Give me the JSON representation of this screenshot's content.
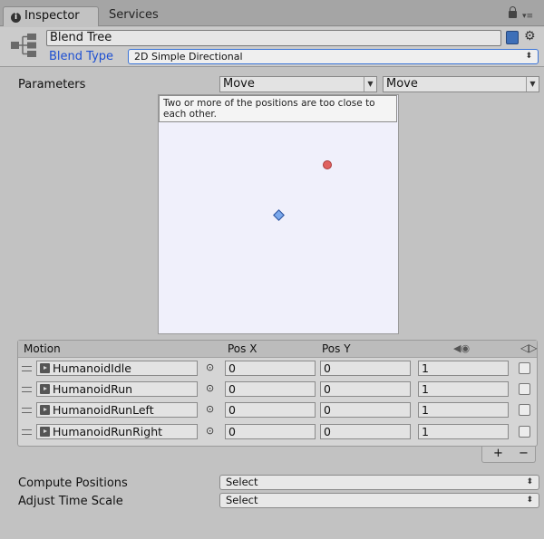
{
  "tabs": [
    {
      "label": "Inspector",
      "active": true
    },
    {
      "label": "Services",
      "active": false
    }
  ],
  "header": {
    "name": "Blend Tree",
    "blend_type_label": "Blend Type",
    "blend_type_value": "2D Simple Directional"
  },
  "parameters": {
    "label": "Parameters",
    "param_x": "Move",
    "param_y": "Move"
  },
  "graph": {
    "warning": "Two or more of the positions are too close to each other."
  },
  "motion_list": {
    "headers": {
      "motion": "Motion",
      "pos_x": "Pos X",
      "pos_y": "Pos Y"
    },
    "rows": [
      {
        "clip": "HumanoidIdle",
        "pos_x": "0",
        "pos_y": "0",
        "speed": "1",
        "mirror": false
      },
      {
        "clip": "HumanoidRun",
        "pos_x": "0",
        "pos_y": "0",
        "speed": "1",
        "mirror": false
      },
      {
        "clip": "HumanoidRunLeft",
        "pos_x": "0",
        "pos_y": "0",
        "speed": "1",
        "mirror": false
      },
      {
        "clip": "HumanoidRunRight",
        "pos_x": "0",
        "pos_y": "0",
        "speed": "1",
        "mirror": false
      }
    ],
    "add_label": "+",
    "remove_label": "−"
  },
  "compute_positions": {
    "label": "Compute Positions",
    "value": "Select"
  },
  "adjust_time_scale": {
    "label": "Adjust Time Scale",
    "value": "Select"
  },
  "colors": {
    "accent": "#3b74d8",
    "label_blue": "#1d4fd1",
    "point_red": "#e0615e",
    "point_blue": "#7aa8ec"
  }
}
